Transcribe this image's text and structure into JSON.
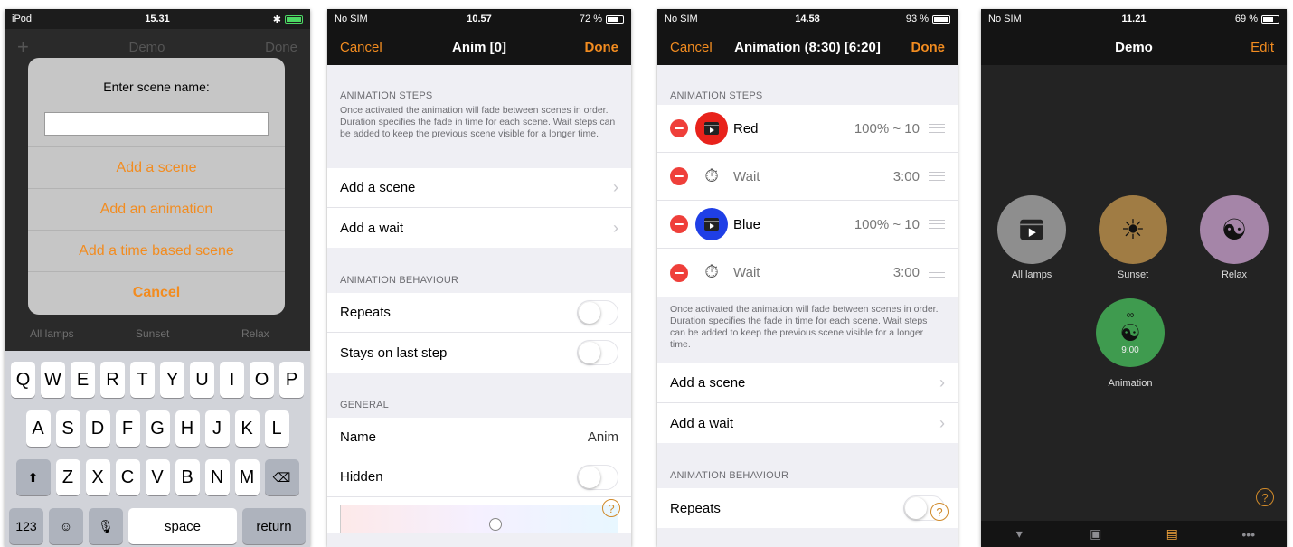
{
  "screen1": {
    "status": {
      "carrier": "iPod",
      "time": "15.31"
    },
    "nav": {
      "left": "+",
      "title": "Demo",
      "right": "Done"
    },
    "dialog": {
      "title": "Enter scene name:",
      "input_value": "",
      "buttons": [
        "Add a scene",
        "Add an animation",
        "Add a time based scene",
        "Cancel"
      ]
    },
    "background_labels": [
      "All lamps",
      "Sunset",
      "Relax"
    ],
    "keyboard": {
      "row1": [
        "Q",
        "W",
        "E",
        "R",
        "T",
        "Y",
        "U",
        "I",
        "O",
        "P"
      ],
      "row2": [
        "A",
        "S",
        "D",
        "F",
        "G",
        "H",
        "J",
        "K",
        "L"
      ],
      "row3": [
        "Z",
        "X",
        "C",
        "V",
        "B",
        "N",
        "M"
      ],
      "numbers": "123",
      "space": "space",
      "return": "return"
    }
  },
  "screen2": {
    "status": {
      "carrier": "No SIM",
      "time": "10.57",
      "battery": "72 %"
    },
    "nav": {
      "cancel": "Cancel",
      "title": "Anim [0]",
      "done": "Done"
    },
    "steps_header": "ANIMATION STEPS",
    "steps_footer": "Once activated the animation will fade between scenes in order. Duration specifies the fade in time for each scene. Wait steps can be added to keep the previous scene visible for a longer time.",
    "add_scene": "Add a scene",
    "add_wait": "Add a wait",
    "behaviour_header": "ANIMATION BEHAVIOUR",
    "repeats": "Repeats",
    "stays": "Stays on last step",
    "general_header": "GENERAL",
    "name_label": "Name",
    "name_value": "Anim",
    "hidden": "Hidden"
  },
  "screen3": {
    "status": {
      "carrier": "No SIM",
      "time": "14.58",
      "battery": "93 %"
    },
    "nav": {
      "cancel": "Cancel",
      "title": "Animation (8:30) [6:20]",
      "done": "Done"
    },
    "steps_header": "ANIMATION STEPS",
    "steps": [
      {
        "name": "Red",
        "value": "100% ~ 10",
        "kind": "scene",
        "color": "#e8221b"
      },
      {
        "name": "Wait",
        "value": "3:00",
        "kind": "wait"
      },
      {
        "name": "Blue",
        "value": "100% ~ 10",
        "kind": "scene",
        "color": "#1f3fe6"
      },
      {
        "name": "Wait",
        "value": "3:00",
        "kind": "wait"
      }
    ],
    "steps_footer": "Once activated the animation will fade between scenes in order. Duration specifies the fade in time for each scene. Wait steps can be added to keep the previous scene visible for a longer time.",
    "add_scene": "Add a scene",
    "add_wait": "Add a wait",
    "behaviour_header": "ANIMATION BEHAVIOUR",
    "repeats": "Repeats"
  },
  "screen4": {
    "status": {
      "carrier": "No SIM",
      "time": "11.21",
      "battery": "69 %"
    },
    "nav": {
      "title": "Demo",
      "edit": "Edit"
    },
    "scenes": [
      {
        "label": "All lamps",
        "color": "#8e8e8e"
      },
      {
        "label": "Sunset",
        "color": "#a07c44"
      },
      {
        "label": "Relax",
        "color": "#a585a8"
      },
      {
        "label": "Animation",
        "color": "#3f9b4f",
        "loop": "∞",
        "time": "9:00"
      }
    ],
    "help": "?"
  },
  "colors": {
    "accent": "#f28c20",
    "destructive": "#ef3f3a"
  }
}
